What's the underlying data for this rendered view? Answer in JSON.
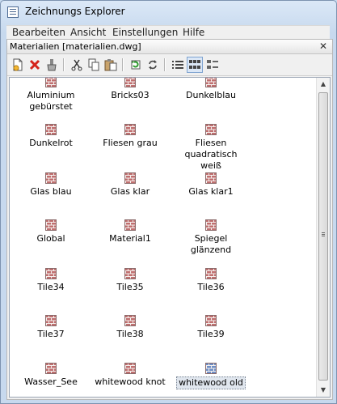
{
  "window": {
    "title": "Zeichnungs Explorer",
    "icon": "app-icon"
  },
  "menubar": [
    {
      "label": "Bearbeiten"
    },
    {
      "label": "Ansicht"
    },
    {
      "label": "Einstellungen"
    },
    {
      "label": "Hilfe"
    }
  ],
  "panel": {
    "title": "Materialien [materialien.dwg]"
  },
  "toolbar": [
    {
      "name": "new-item-icon"
    },
    {
      "name": "delete-icon"
    },
    {
      "name": "purge-icon"
    },
    {
      "name": "cut-icon"
    },
    {
      "name": "copy-icon"
    },
    {
      "name": "paste-icon"
    },
    {
      "name": "refresh-icon"
    },
    {
      "name": "sync-icon"
    },
    {
      "name": "list-view-icon"
    },
    {
      "name": "icon-view-icon",
      "active": true
    },
    {
      "name": "detail-view-icon"
    }
  ],
  "materials": [
    {
      "label": "Aluminium",
      "label2": "gebürstet"
    },
    {
      "label": "Bricks03"
    },
    {
      "label": "Dunkelblau"
    },
    {
      "label": "Dunkelrot"
    },
    {
      "label": "Fliesen grau"
    },
    {
      "label": "Fliesen",
      "label2": "quadratisch weiß"
    },
    {
      "label": "Glas blau"
    },
    {
      "label": "Glas klar"
    },
    {
      "label": "Glas klar1"
    },
    {
      "label": "Global"
    },
    {
      "label": "Material1"
    },
    {
      "label": "Spiegel glänzend"
    },
    {
      "label": "Tile34"
    },
    {
      "label": "Tile35"
    },
    {
      "label": "Tile36"
    },
    {
      "label": "Tile37"
    },
    {
      "label": "Tile38"
    },
    {
      "label": "Tile39"
    },
    {
      "label": "Wasser_See"
    },
    {
      "label": "whitewood knot"
    },
    {
      "label": "whitewood old",
      "selected": true
    }
  ],
  "colors": {
    "brick": "#c07070",
    "brick_selected": "#6f8fc6",
    "mortar": "#f5f0ee"
  }
}
